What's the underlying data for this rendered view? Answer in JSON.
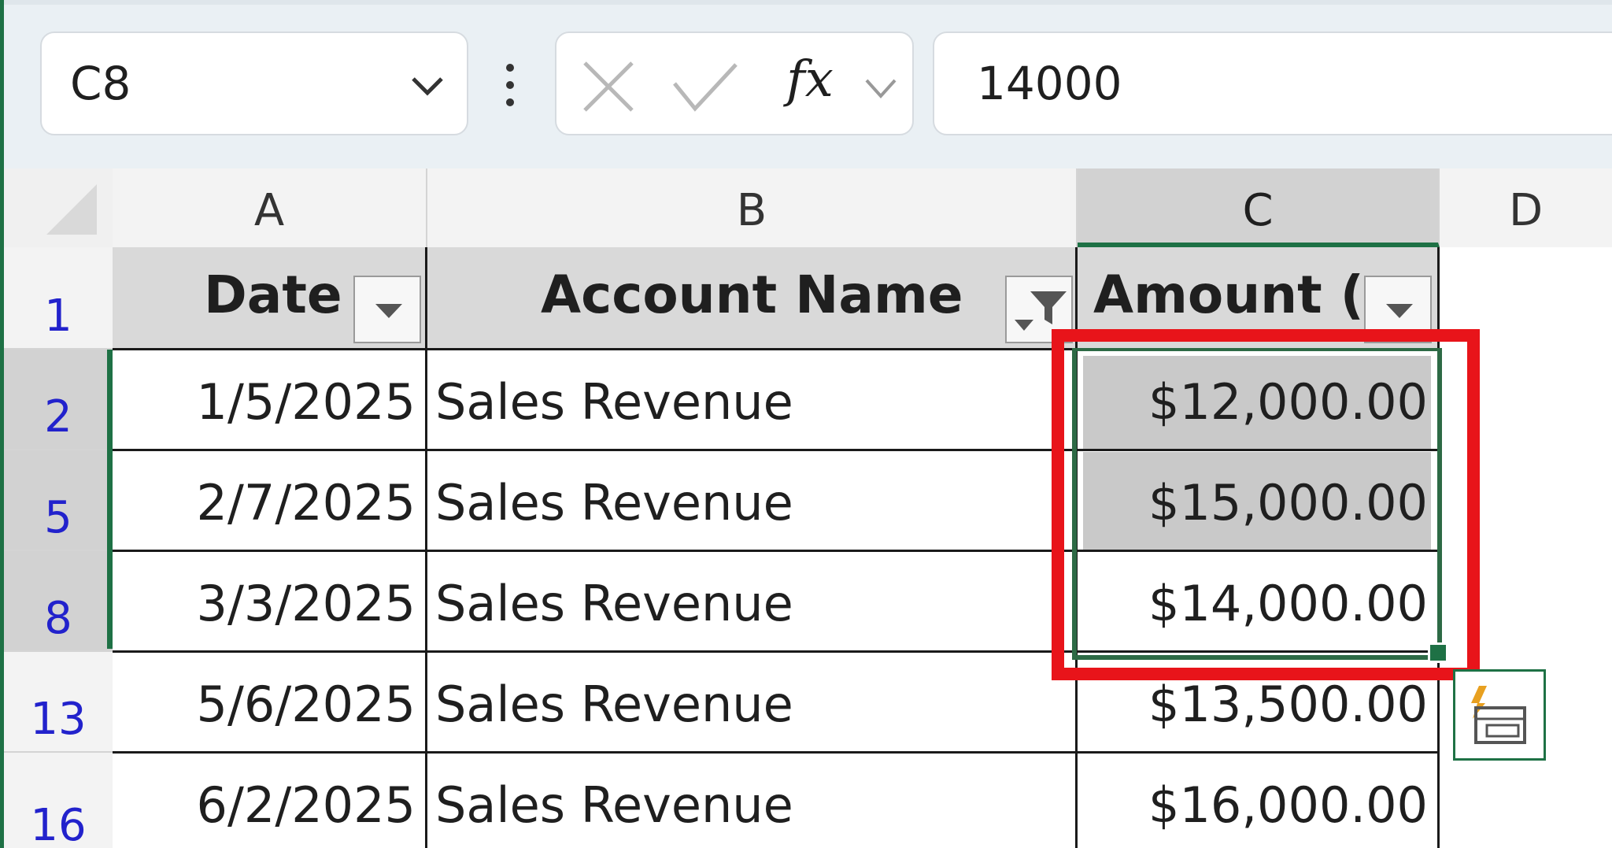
{
  "name_box": {
    "value": "C8"
  },
  "formula_bar": {
    "fx_label": "fx",
    "value": "14000"
  },
  "columns": [
    "A",
    "B",
    "C",
    "D"
  ],
  "selected_column": "C",
  "row_headers": [
    "1",
    "2",
    "5",
    "8",
    "13",
    "16"
  ],
  "table": {
    "headers": [
      "Date",
      "Account Name",
      "Amount ("
    ],
    "rows": [
      {
        "date": "1/5/2025",
        "account": "Sales Revenue",
        "amount": "$12,000.00"
      },
      {
        "date": "2/7/2025",
        "account": "Sales Revenue",
        "amount": "$15,000.00"
      },
      {
        "date": "3/3/2025",
        "account": "Sales Revenue",
        "amount": "$14,000.00"
      },
      {
        "date": "5/6/2025",
        "account": "Sales Revenue",
        "amount": "$13,500.00"
      },
      {
        "date": "6/2/2025",
        "account": "Sales Revenue",
        "amount": "$16,000.00"
      }
    ]
  },
  "filters": {
    "date": "dropdown-arrow-icon",
    "account": "filter-funnel-icon",
    "amount": "dropdown-arrow-icon"
  },
  "colors": {
    "accent_green": "#1e7145",
    "highlight_red": "#e8141a",
    "header_fill": "#d9d9d9",
    "row_number_blue": "#2222cc"
  }
}
